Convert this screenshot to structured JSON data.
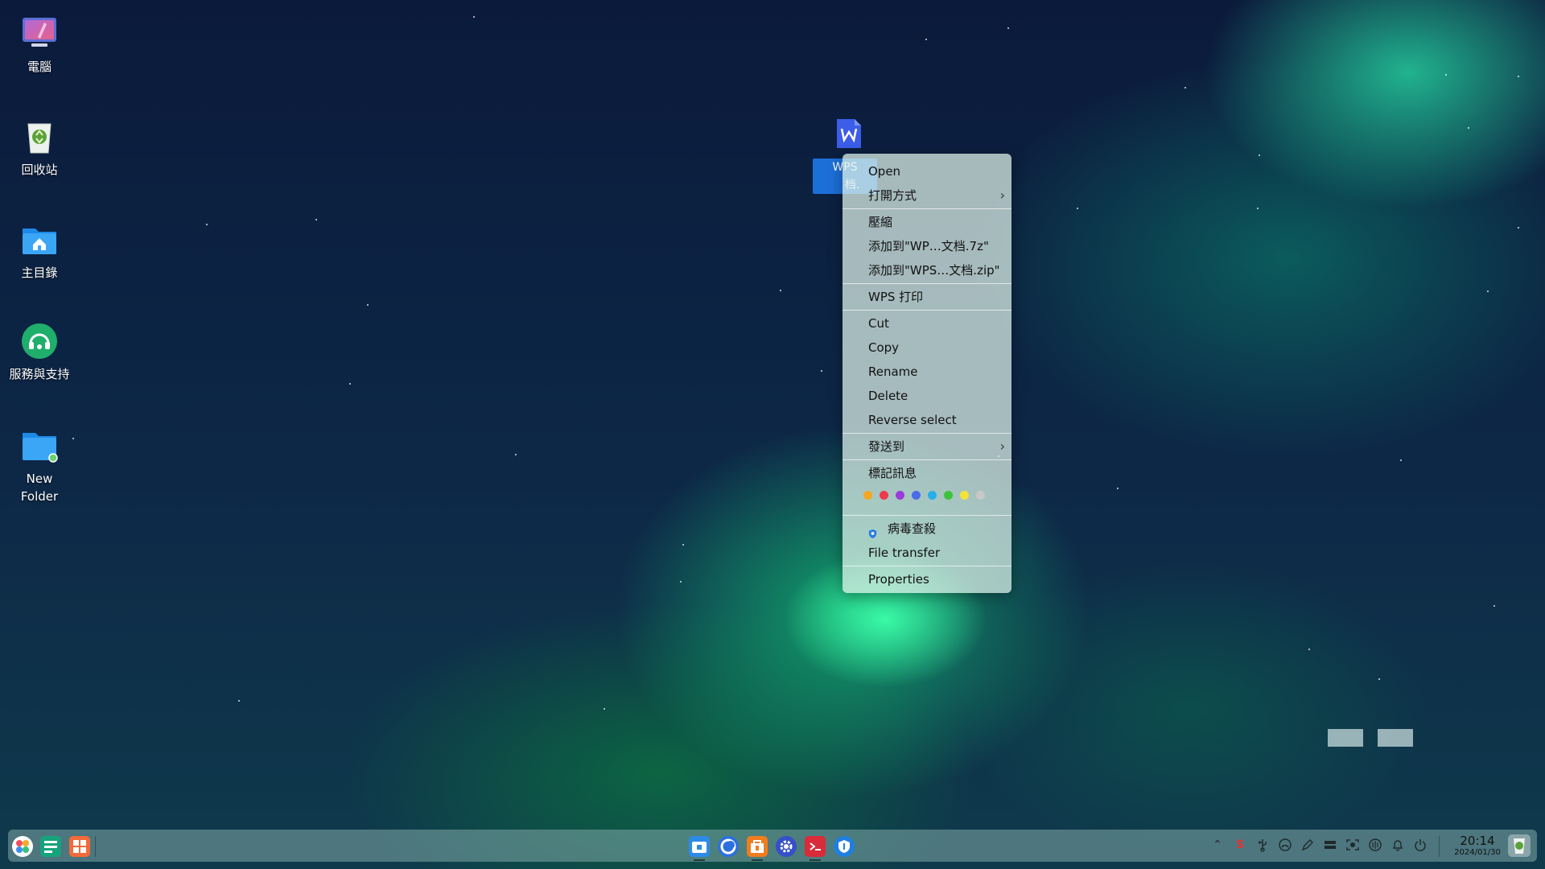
{
  "desktop": {
    "icons": [
      {
        "label": "電腦"
      },
      {
        "label": "回收站"
      },
      {
        "label": "主目錄"
      },
      {
        "label": "服務與支持"
      },
      {
        "label": "New Folder"
      }
    ],
    "selected_file": {
      "label_line1": "WPS",
      "label_line2": "档."
    }
  },
  "context_menu": {
    "open": "Open",
    "open_with": "打開方式",
    "compress": "壓縮",
    "add_7z": "添加到\"WP…文档.7z\"",
    "add_zip": "添加到\"WPS…文档.zip\"",
    "wps_print": "WPS 打印",
    "cut": "Cut",
    "copy": "Copy",
    "rename": "Rename",
    "delete": "Delete",
    "reverse_select": "Reverse select",
    "send_to": "發送到",
    "tag_info": "標記訊息",
    "tag_colors": [
      "#f5a623",
      "#ee3a4a",
      "#9b3bdc",
      "#4b6ce8",
      "#2aaee8",
      "#3cc23c",
      "#f3e23a",
      "#c8c8c8"
    ],
    "virus_scan": "病毒查殺",
    "file_transfer": "File transfer",
    "properties": "Properties"
  },
  "taskbar": {
    "time": "20:14",
    "date": "2024/01/30"
  }
}
